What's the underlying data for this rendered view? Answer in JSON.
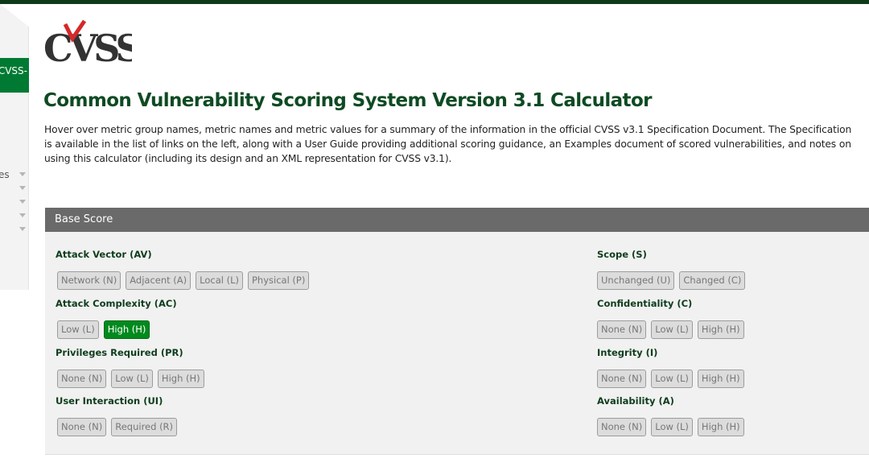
{
  "sidebar": {
    "active_item": "CVSS-",
    "menu_items": [
      {
        "label": "es"
      },
      {
        "label": ""
      },
      {
        "label": ""
      },
      {
        "label": ""
      },
      {
        "label": ""
      }
    ]
  },
  "logo": {
    "text": "CVSS",
    "accent_color": "#d62828"
  },
  "page": {
    "title": "Common Vulnerability Scoring System Version 3.1 Calculator",
    "intro": "Hover over metric group names, metric names and metric values for a summary of the information in the official CVSS v3.1 Specification Document. The Specification is available in the list of links on the left, along with a User Guide providing additional scoring guidance, an Examples document of scored vulnerabilities, and notes on using this calculator (including its design and an XML representation for CVSS v3.1)."
  },
  "base_score": {
    "header": "Base Score",
    "metrics": {
      "av": {
        "label": "Attack Vector (AV)",
        "options": [
          {
            "label": "Network (N)",
            "selected": false
          },
          {
            "label": "Adjacent (A)",
            "selected": false
          },
          {
            "label": "Local (L)",
            "selected": false
          },
          {
            "label": "Physical (P)",
            "selected": false
          }
        ]
      },
      "ac": {
        "label": "Attack Complexity (AC)",
        "options": [
          {
            "label": "Low (L)",
            "selected": false
          },
          {
            "label": "High (H)",
            "selected": true
          }
        ]
      },
      "pr": {
        "label": "Privileges Required (PR)",
        "options": [
          {
            "label": "None (N)",
            "selected": false
          },
          {
            "label": "Low (L)",
            "selected": false
          },
          {
            "label": "High (H)",
            "selected": false
          }
        ]
      },
      "ui": {
        "label": "User Interaction (UI)",
        "options": [
          {
            "label": "None (N)",
            "selected": false
          },
          {
            "label": "Required (R)",
            "selected": false
          }
        ]
      },
      "s": {
        "label": "Scope (S)",
        "options": [
          {
            "label": "Unchanged (U)",
            "selected": false
          },
          {
            "label": "Changed (C)",
            "selected": false
          }
        ]
      },
      "c": {
        "label": "Confidentiality (C)",
        "options": [
          {
            "label": "None (N)",
            "selected": false
          },
          {
            "label": "Low (L)",
            "selected": false
          },
          {
            "label": "High (H)",
            "selected": false
          }
        ]
      },
      "i": {
        "label": "Integrity (I)",
        "options": [
          {
            "label": "None (N)",
            "selected": false
          },
          {
            "label": "Low (L)",
            "selected": false
          },
          {
            "label": "High (H)",
            "selected": false
          }
        ]
      },
      "a": {
        "label": "Availability (A)",
        "options": [
          {
            "label": "None (N)",
            "selected": false
          },
          {
            "label": "Low (L)",
            "selected": false
          },
          {
            "label": "High (H)",
            "selected": false
          }
        ]
      }
    }
  },
  "colors": {
    "selected": "#008a1e",
    "title": "#0e4a23",
    "header_bar": "#6a6a6a",
    "top_bar": "#0d3b1a"
  }
}
